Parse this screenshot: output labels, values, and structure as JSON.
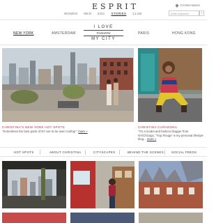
{
  "header": {
    "logo": "ESPRIT",
    "store_finder": "STOREFINDER",
    "nav": [
      "WOMEN",
      "MEN",
      "EDC",
      "STORIES",
      "CLUB"
    ],
    "active_nav": "STORIES",
    "search_placeholder": "Enter keyword",
    "search_button": "›"
  },
  "cities": {
    "left": [
      "NEW YORK",
      "AMSTERDAM"
    ],
    "right": [
      "PARIS",
      "HONG KONG"
    ],
    "active": "NEW YORK",
    "title_top": "I LOVE",
    "title_mid": "FASHION",
    "title_bottom": "MY CITY"
  },
  "feature_left": {
    "title": "CHRISTINA'S NEW YORK HOT SPOTS",
    "text": "\"Sometimes the best parts of NY are to be seen rooftop.\"",
    "more": "more »"
  },
  "feature_right": {
    "title": "CHRISTINA CARADONA",
    "text": "\"I'm a model and fashion blogger from NY/Chicago. 'Trop Rouge' is my personal lifestyle blog...",
    "more": "more »"
  },
  "subnav": [
    "HOT SPOTS",
    "ABOUT CHRISTINA",
    "CITYSCAPES",
    "BEHIND THE SCENES",
    "SOCIAL FEEDS"
  ],
  "colors": {
    "accent": "#d3232b",
    "text": "#333333",
    "rule": "#e2e2e2"
  }
}
